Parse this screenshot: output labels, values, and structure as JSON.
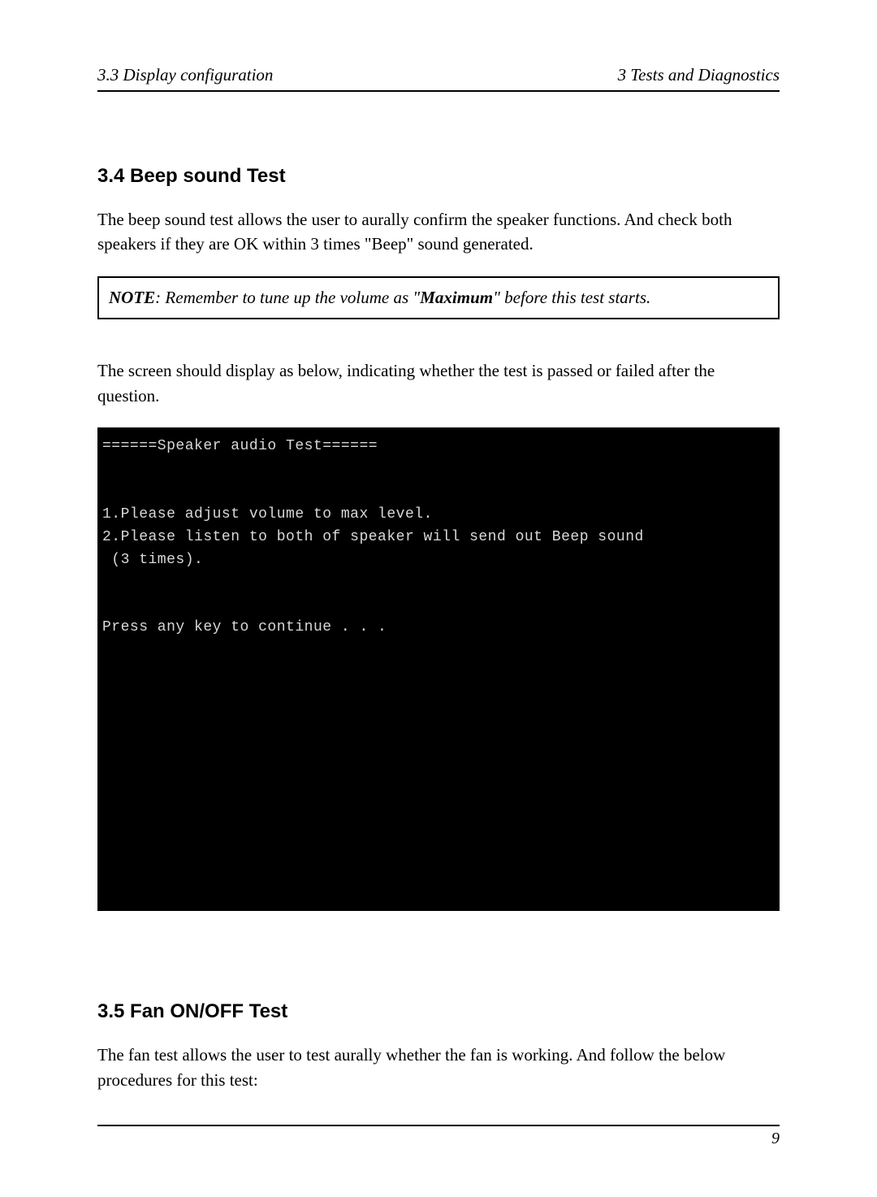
{
  "header": {
    "left": "3.3 Display configuration",
    "right": "3 Tests and Diagnostics"
  },
  "section_beep": {
    "heading": "3.4 Beep sound Test",
    "para1": "The beep sound test allows the user to aurally confirm the speaker functions. And check both speakers if they are OK within 3 times \"Beep\" sound generated.",
    "note_label": "NOTE",
    "note_pre": ":  Remember to tune up the volume as \"",
    "note_bold": "Maximum",
    "note_post": "\" before this test starts.",
    "para2": "The screen should display as below, indicating whether the test is passed or failed after the question."
  },
  "terminal": {
    "line1": "======Speaker audio Test======",
    "line2": "",
    "line3": "",
    "line4": "1.Please adjust volume to max level.",
    "line5": "2.Please listen to both of speaker will send out Beep sound",
    "line6": " (3 times).",
    "line7": "",
    "line8": "",
    "line9": "Press any key to continue . . ."
  },
  "section_fan": {
    "heading": "3.5 Fan ON/OFF Test",
    "para1": "The fan test allows the user to test aurally whether the fan is working. And follow the below procedures for this test:"
  },
  "footer": {
    "page_number": "9"
  }
}
